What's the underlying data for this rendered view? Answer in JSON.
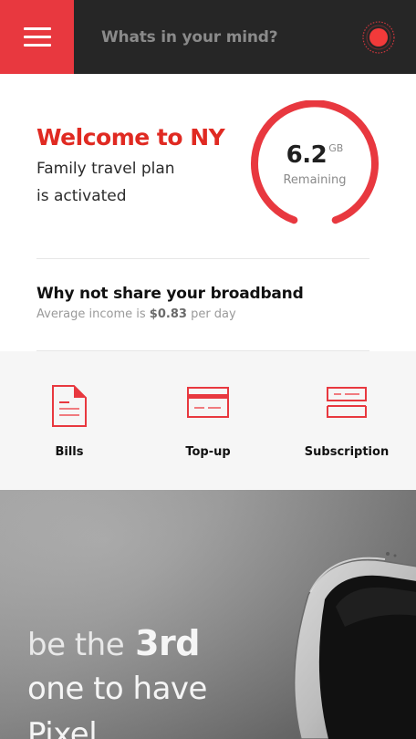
{
  "header": {
    "search_placeholder": "Whats in your mind?",
    "menu_icon": "hamburger-menu-icon",
    "record_icon": "record-dot-icon"
  },
  "welcome": {
    "title": "Welcome to NY",
    "subtitle_line1": "Family travel plan",
    "subtitle_line2": "is activated"
  },
  "data_gauge": {
    "value": "6.2",
    "unit": "GB",
    "label": "Remaining"
  },
  "share": {
    "title": "Why not share your broadband",
    "subtitle_prefix": "Average income is",
    "amount": "$0.83",
    "subtitle_suffix": "per day"
  },
  "actions": [
    {
      "label": "Bills",
      "icon": "document-icon"
    },
    {
      "label": "Top-up",
      "icon": "card-icon"
    },
    {
      "label": "Subscription",
      "icon": "subscription-card-icon"
    }
  ],
  "promo": {
    "line1_light": "be the",
    "line1_strong": "3rd",
    "line2": "one to have",
    "line3": "Pixel"
  },
  "colors": {
    "accent": "#e8383f",
    "header_bg": "#262626",
    "title_red": "#e02a22",
    "actions_bg": "#f6f6f6"
  }
}
